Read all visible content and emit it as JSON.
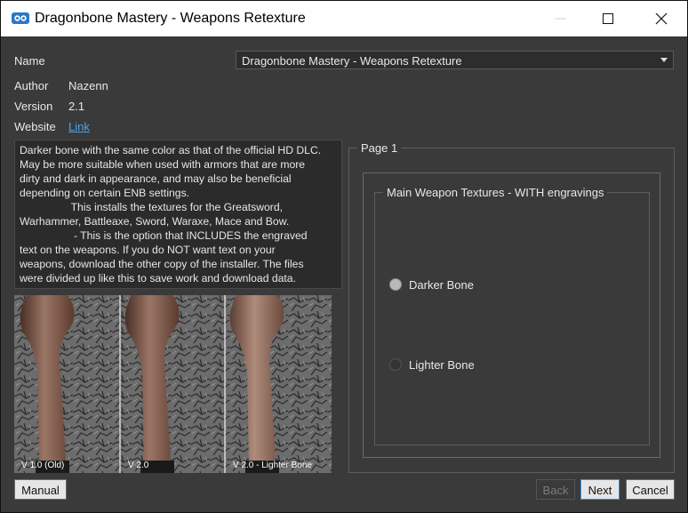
{
  "window": {
    "title": "Dragonbone Mastery - Weapons Retexture"
  },
  "fields": {
    "name_label": "Name",
    "author_label": "Author",
    "author_value": "Nazenn",
    "version_label": "Version",
    "version_value": "2.1",
    "website_label": "Website",
    "website_link": "Link"
  },
  "name_select": {
    "selected": "Dragonbone Mastery - Weapons Retexture"
  },
  "description": "Darker bone with the same color as that of the official HD DLC.\nMay be more suitable when used with armors that are more\ndirty and dark in appearance, and may also be beneficial\ndepending on certain ENB settings.\n                 This installs the textures for the Greatsword,\nWarhammer, Battleaxe, Sword, Waraxe, Mace and Bow.\n                  - This is the option that INCLUDES the engraved\ntext on the weapons. If you do NOT want text on your\nweapons, download the other copy of the installer. The files\nwere divided up like this to save work and download data.",
  "preview": {
    "captions": [
      "V 1.0 (Old)",
      "V 2.0",
      "V 2.0 - Lighter Bone"
    ]
  },
  "page": {
    "title": "Page 1",
    "group_title": "Main Weapon Textures - WITH engravings",
    "options": [
      {
        "label": "Darker Bone",
        "selected": true
      },
      {
        "label": "Lighter Bone",
        "selected": false
      }
    ]
  },
  "buttons": {
    "manual": "Manual",
    "back": "Back",
    "next": "Next",
    "cancel": "Cancel"
  },
  "colors": {
    "background": "#3a3a3a",
    "link": "#4ba3e6",
    "focus": "#3f8fe0"
  }
}
